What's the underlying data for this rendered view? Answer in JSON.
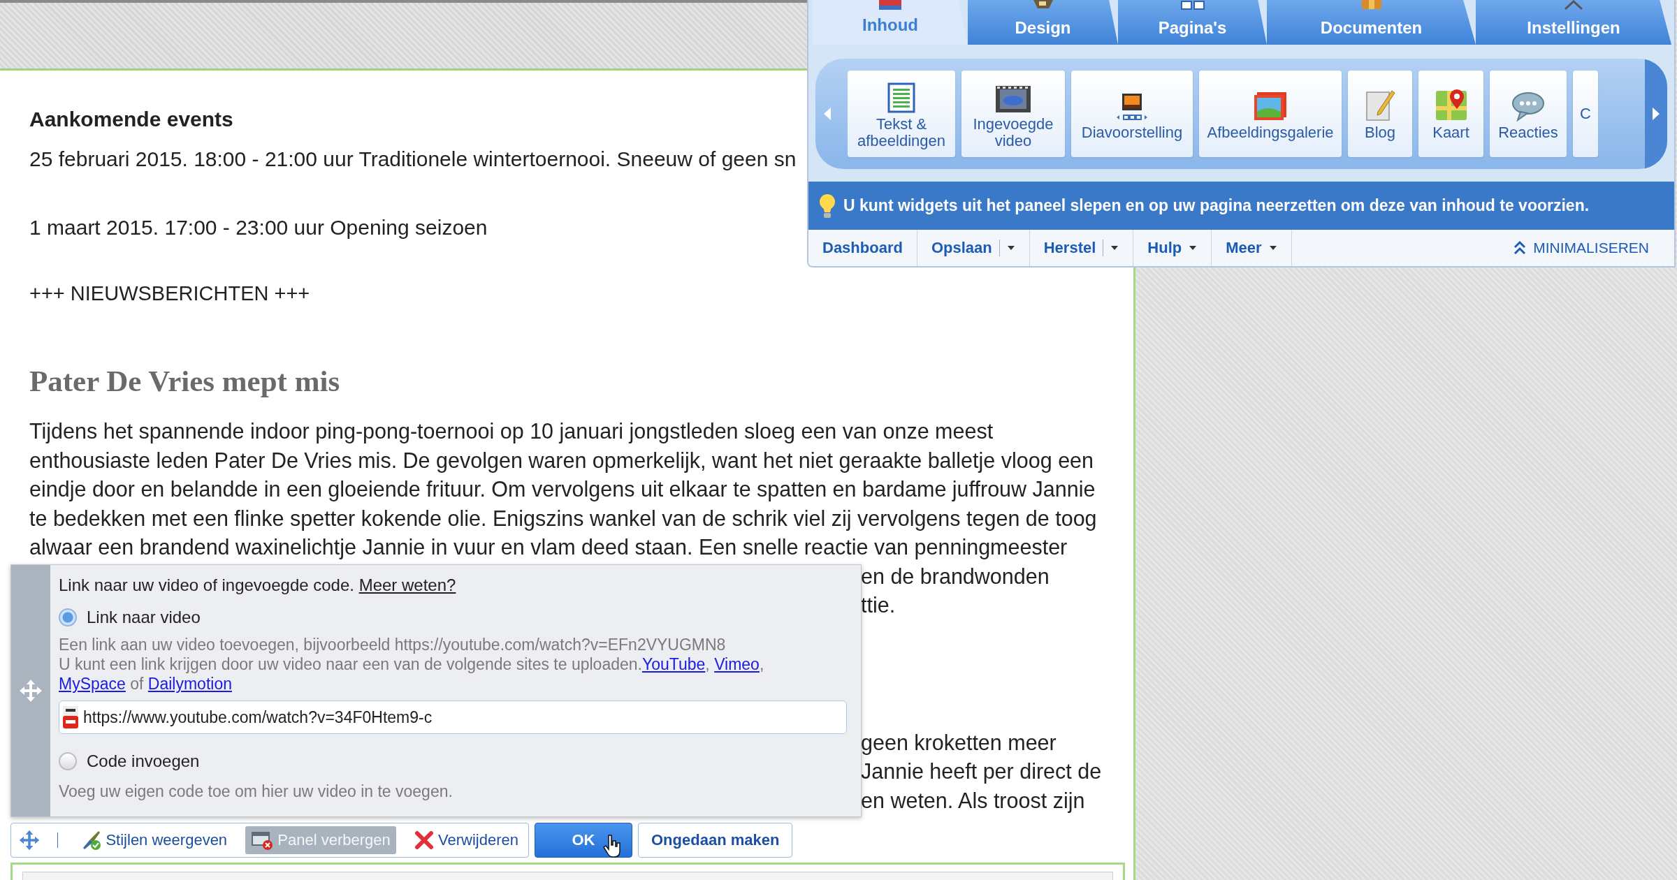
{
  "page": {
    "events": {
      "heading": "Aankomende events",
      "items": [
        "25 februari 2015. 18:00 - 21:00 uur Traditionele wintertoernooi. Sneeuw of geen sn",
        "1 maart 2015. 17:00 - 23:00 uur Opening seizoen"
      ]
    },
    "news_label": "+++ NIEUWSBERICHTEN +++",
    "article": {
      "title": "Pater De Vries mept mis",
      "lines": [
        "Tijdens het spannende indoor ping-pong-toernooi op 10 januari jongstleden sloeg een van onze meest",
        "enthousiaste leden Pater De Vries mis. De gevolgen waren opmerkelijk, want het niet geraakte balletje vloog een",
        "eindje door en belandde in een gloeiende frituur. Om vervolgens uit elkaar te spatten en bardame juffrouw Jannie",
        "te bedekken met een flinke spetter kokende olie. Enigszins wankel van de schrik viel zij vervolgens tegen de toog",
        "alwaar een brandend waxinelichtje Jannie in vuur en vlam deed staan. Een snelle reactie van penningmeester"
      ],
      "visible_line_ends": [
        [
          "en de brandwonden",
          "ttie."
        ],
        [
          "geen kroketten meer",
          "Jannie heeft per direct de",
          "en weten. Als troost zijn"
        ]
      ]
    }
  },
  "editor_panel": {
    "tabs": [
      {
        "label": "Inhoud",
        "selected": true
      },
      {
        "label": "Design",
        "selected": false
      },
      {
        "label": "Pagina's",
        "selected": false
      },
      {
        "label": "Documenten",
        "selected": false
      },
      {
        "label": "Instellingen",
        "selected": false
      }
    ],
    "widgets": [
      {
        "label": "Tekst & afbeeldingen"
      },
      {
        "label": "Ingevoegde video"
      },
      {
        "label": "Diavoorstelling"
      },
      {
        "label": "Afbeeldingsgalerie"
      },
      {
        "label": "Blog"
      },
      {
        "label": "Kaart"
      },
      {
        "label": "Reacties"
      },
      {
        "label": "C"
      }
    ],
    "tip": "U kunt widgets uit het paneel slepen en op uw pagina neerzetten om deze van inhoud te voorzien.",
    "menu": [
      {
        "label": "Dashboard",
        "dropdown": false
      },
      {
        "label": "Opslaan",
        "dropdown": true
      },
      {
        "label": "Herstel",
        "dropdown": true
      },
      {
        "label": "Hulp",
        "dropdown": true
      },
      {
        "label": "Meer",
        "dropdown": true
      }
    ],
    "minimize": "MINIMALISEREN"
  },
  "video_dialog": {
    "intro": "Link naar uw video of ingevoegde code.",
    "intro_link": "Meer weten?",
    "options": [
      {
        "label": "Link naar video",
        "selected": true
      },
      {
        "label": "Code invoegen",
        "selected": false
      }
    ],
    "link_hint": "Een link aan uw video toevoegen, bijvoorbeeld https://youtube.com/watch?v=EFn2VYUGMN8",
    "sites_hint": [
      [
        {
          "text": "U kunt een link krijgen door uw video naar een van de volgende sites te uploaden."
        },
        {
          "link": "YouTube"
        },
        {
          "text": ", "
        },
        {
          "link": "Vimeo"
        },
        {
          "text": ","
        }
      ],
      [
        {
          "link": "MySpace"
        },
        {
          "text": " of "
        },
        {
          "link": "Dailymotion"
        }
      ]
    ],
    "url": "https://www.youtube.com/watch?v=34F0Htem9-c",
    "code_hint": "Voeg uw eigen code toe om hier uw video in te voegen."
  },
  "toolbar": {
    "items": [
      {
        "label": "Stijlen weergeven",
        "pressed": false
      },
      {
        "label": "Panel verbergen",
        "pressed": true
      },
      {
        "label": "Verwijderen",
        "pressed": false
      }
    ],
    "ok": "OK",
    "undo": "Ongedaan maken"
  }
}
